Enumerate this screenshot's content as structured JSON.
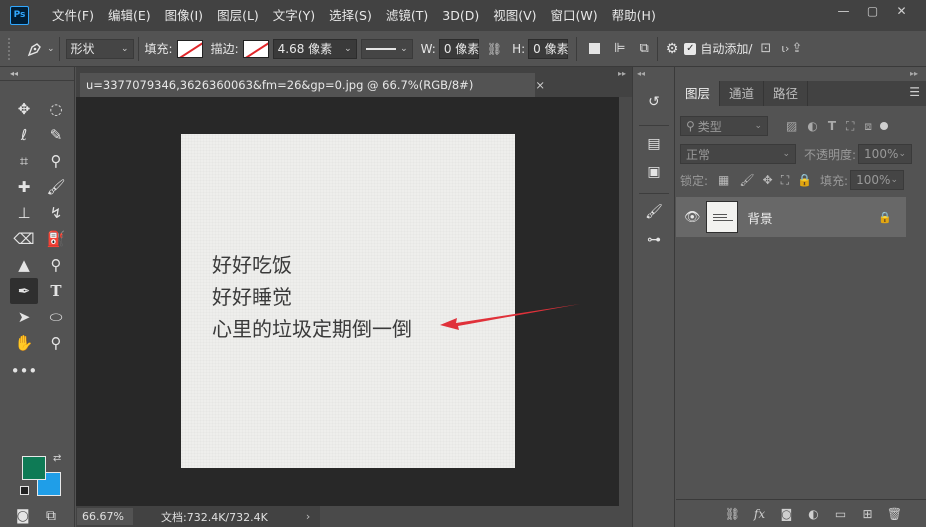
{
  "app": {
    "logo": "Ps",
    "menu": [
      "文件(F)",
      "编辑(E)",
      "图像(I)",
      "图层(L)",
      "文字(Y)",
      "选择(S)",
      "滤镜(T)",
      "3D(D)",
      "视图(V)",
      "窗口(W)",
      "帮助(H)"
    ],
    "window_controls": {
      "minimize": "—",
      "restore": "▢",
      "close": "✕"
    }
  },
  "options_bar": {
    "tool_icon": "pen-tool-icon",
    "mode": "形状",
    "fill_label": "填充:",
    "stroke_label": "描边:",
    "stroke_width": "4.68 像素",
    "w_label": "W:",
    "w_value": "0 像素",
    "h_label": "H:",
    "h_value": "0 像素",
    "auto_add": "自动添加/"
  },
  "document": {
    "tab_title": "u=3377079346,3626360063&fm=26&gp=0.jpg @ 66.7%(RGB/8#)",
    "close": "×",
    "text_lines": [
      "好好吃饭",
      "好好睡觉",
      "心里的垃圾定期倒一倒"
    ],
    "arrow_color": "#e0313a"
  },
  "status": {
    "zoom": "66.67%",
    "doc_info": "文档:732.4K/732.4K",
    "arrow": "›"
  },
  "colors": {
    "foreground": "#0e7a55",
    "background": "#1f9ee8"
  },
  "layers_panel": {
    "tabs": [
      "图层",
      "通道",
      "路径"
    ],
    "filter_kind": "类型",
    "blend_mode": "正常",
    "opacity_label": "不透明度:",
    "opacity_value": "100%",
    "lock_label": "锁定:",
    "fill_label": "填充:",
    "fill_value": "100%",
    "layers": [
      {
        "name": "背景",
        "visible": true,
        "locked": true
      }
    ]
  }
}
